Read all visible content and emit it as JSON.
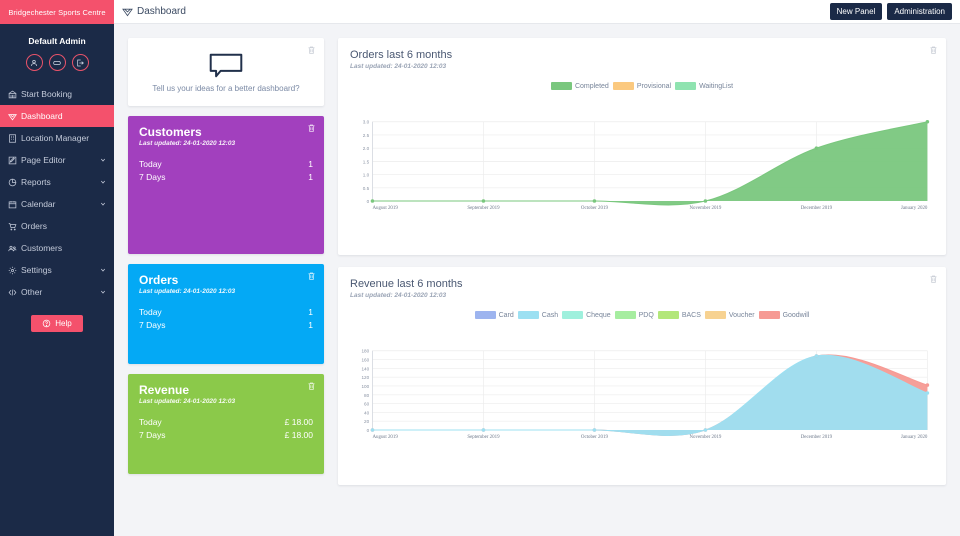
{
  "sidebar": {
    "brand": "Bridgechester Sports Centre",
    "user_name": "Default Admin",
    "user_actions": [
      {
        "name": "profile-icon",
        "label": "Profile"
      },
      {
        "name": "mask-icon",
        "label": "Impersonate"
      },
      {
        "name": "logout-icon",
        "label": "Logout"
      }
    ],
    "items": [
      {
        "label": "Start Booking",
        "icon": "calendar-booking-icon",
        "active": false,
        "expandable": false
      },
      {
        "label": "Dashboard",
        "icon": "dashboard-heart-icon",
        "active": true,
        "expandable": false
      },
      {
        "label": "Location Manager",
        "icon": "building-icon",
        "active": false,
        "expandable": false
      },
      {
        "label": "Page Editor",
        "icon": "edit-page-icon",
        "active": false,
        "expandable": true
      },
      {
        "label": "Reports",
        "icon": "pie-chart-icon",
        "active": false,
        "expandable": true
      },
      {
        "label": "Calendar",
        "icon": "calendar-icon",
        "active": false,
        "expandable": true
      },
      {
        "label": "Orders",
        "icon": "cart-icon",
        "active": false,
        "expandable": false
      },
      {
        "label": "Customers",
        "icon": "people-icon",
        "active": false,
        "expandable": false
      },
      {
        "label": "Settings",
        "icon": "gear-icon",
        "active": false,
        "expandable": true
      },
      {
        "label": "Other",
        "icon": "code-icon",
        "active": false,
        "expandable": true
      }
    ],
    "help_label": "Help"
  },
  "topbar": {
    "page_title": "Dashboard",
    "new_panel_label": "New Panel",
    "administration_label": "Administration"
  },
  "idea_card": {
    "text": "Tell us your ideas for a better dashboard?"
  },
  "stat_cards": [
    {
      "title": "Customers",
      "subtitle": "Last updated: 24-01-2020 12:03",
      "color": "#a240be",
      "rows": [
        {
          "label": "Today",
          "value": "1"
        },
        {
          "label": "7 Days",
          "value": "1"
        }
      ]
    },
    {
      "title": "Orders",
      "subtitle": "Last updated: 24-01-2020 12:03",
      "color": "#04a9f5",
      "rows": [
        {
          "label": "Today",
          "value": "1"
        },
        {
          "label": "7 Days",
          "value": "1"
        }
      ]
    },
    {
      "title": "Revenue",
      "subtitle": "Last updated: 24-01-2020 12:03",
      "color": "#8bc94a",
      "rows": [
        {
          "label": "Today",
          "value": "£ 18.00"
        },
        {
          "label": "7 Days",
          "value": "£ 18.00"
        }
      ]
    }
  ],
  "charts": [
    {
      "title": "Orders last 6 months",
      "subtitle": "Last updated: 24-01-2020 12:03"
    },
    {
      "title": "Revenue last 6 months",
      "subtitle": "Last updated: 24-01-2020 12:03"
    }
  ],
  "chart_data": [
    {
      "type": "area",
      "title": "Orders last 6 months",
      "categories": [
        "August 2019",
        "September 2019",
        "October 2019",
        "November 2019",
        "December 2019",
        "January 2020"
      ],
      "series": [
        {
          "name": "Completed",
          "color": "#7ac77e",
          "values": [
            0,
            0,
            0,
            0,
            2,
            3
          ]
        },
        {
          "name": "Provisional",
          "color": "#fbc97f",
          "values": [
            0,
            0,
            0,
            0,
            0,
            0
          ]
        },
        {
          "name": "WaitingList",
          "color": "#8fe3b0",
          "values": [
            0,
            0,
            0,
            0,
            0,
            0
          ]
        }
      ],
      "xlabel": "",
      "ylabel": "",
      "ylim": [
        0,
        3
      ],
      "yticks": [
        "0",
        "0.5",
        "1.0",
        "1.5",
        "2.0",
        "2.5",
        "3.0"
      ],
      "grid": true,
      "legend_position": "top"
    },
    {
      "type": "area",
      "title": "Revenue last 6 months",
      "categories": [
        "August 2019",
        "September 2019",
        "October 2019",
        "November 2019",
        "December 2019",
        "January 2020"
      ],
      "series": [
        {
          "name": "Card",
          "color": "#9db4ef",
          "values": [
            0,
            0,
            0,
            0,
            0,
            0
          ]
        },
        {
          "name": "Cash",
          "color": "#9ce0f2",
          "values": [
            0,
            0,
            0,
            0,
            168,
            84
          ]
        },
        {
          "name": "Cheque",
          "color": "#9ff0dd",
          "values": [
            0,
            0,
            0,
            0,
            0,
            0
          ]
        },
        {
          "name": "PDQ",
          "color": "#a6eda0",
          "values": [
            0,
            0,
            0,
            0,
            0,
            0
          ]
        },
        {
          "name": "BACS",
          "color": "#b3e77a",
          "values": [
            0,
            0,
            0,
            0,
            0,
            0
          ]
        },
        {
          "name": "Voucher",
          "color": "#f7d291",
          "values": [
            0,
            0,
            0,
            0,
            0,
            0
          ]
        },
        {
          "name": "Goodwill",
          "color": "#f69a94",
          "values": [
            0,
            0,
            0,
            0,
            168,
            102
          ]
        }
      ],
      "xlabel": "",
      "ylabel": "",
      "ylim": [
        0,
        180
      ],
      "yticks": [
        "0",
        "20",
        "40",
        "60",
        "80",
        "100",
        "120",
        "140",
        "160",
        "180"
      ],
      "grid": true,
      "legend_position": "top"
    }
  ]
}
